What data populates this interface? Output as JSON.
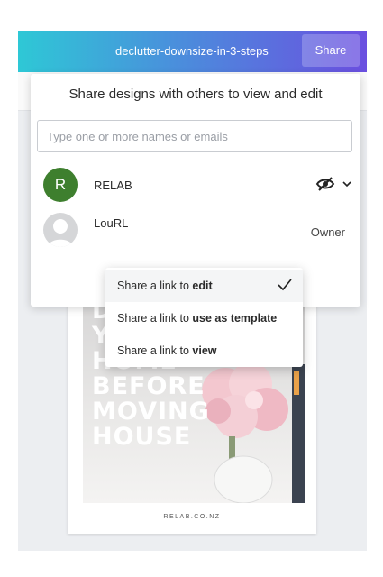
{
  "header": {
    "filename": "declutter-downsize-in-3-steps",
    "share_label": "Share"
  },
  "share_panel": {
    "title": "Share designs with others to view and edit",
    "input_placeholder": "Type one or more names or emails",
    "members": [
      {
        "initial": "R",
        "name": "RELAB",
        "avatar_color": "#3e7f2e",
        "permission_icon": "eye-hidden-icon"
      },
      {
        "name": "LouRL",
        "role": "Owner"
      }
    ]
  },
  "link_menu": {
    "items": [
      {
        "prefix": "Share a link to ",
        "emphasis": "edit",
        "selected": true
      },
      {
        "prefix": "Share a link to ",
        "emphasis": "use as template",
        "selected": false
      },
      {
        "prefix": "Share a link to ",
        "emphasis": "view",
        "selected": false
      }
    ]
  },
  "design": {
    "headline_lines": [
      "D",
      "Y",
      "HOME",
      "BEFORE",
      "MOVING",
      "HOUSE"
    ],
    "site": "RELAB.CO.NZ"
  }
}
